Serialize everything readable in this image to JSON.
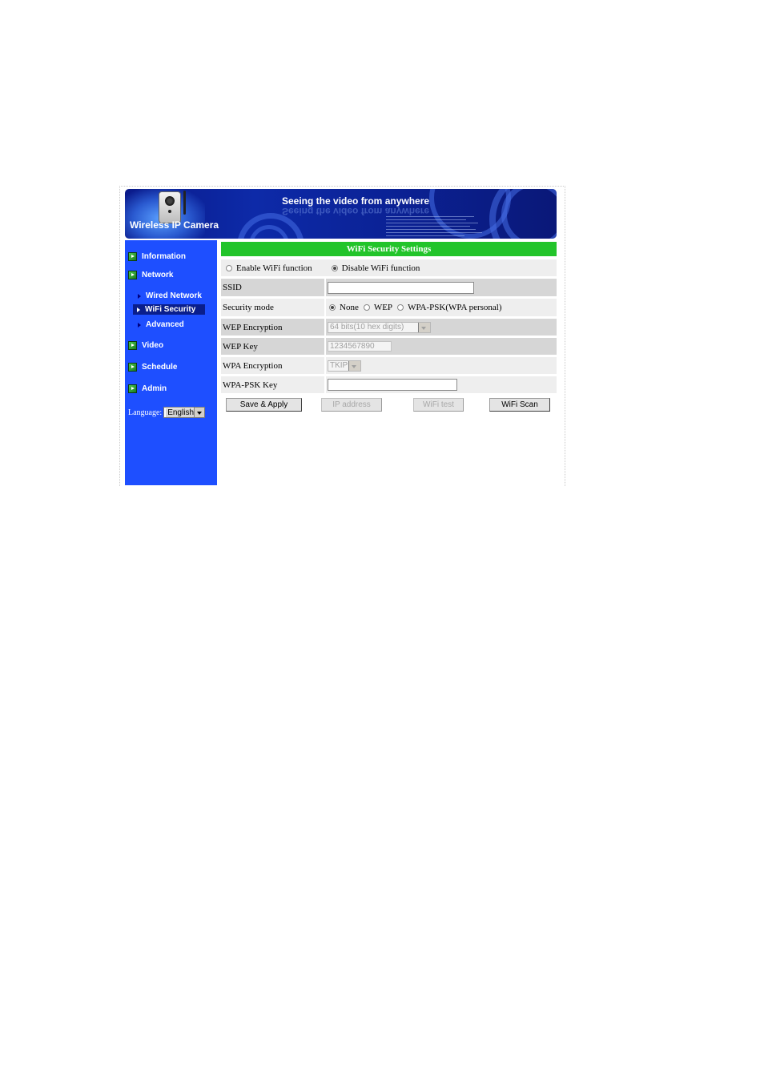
{
  "banner": {
    "title": "Wireless IP Camera",
    "slogan": "Seeing the video from anywhere"
  },
  "sidebar": {
    "items": [
      {
        "label": "Information"
      },
      {
        "label": "Network"
      },
      {
        "label": "Video"
      },
      {
        "label": "Schedule"
      },
      {
        "label": "Admin"
      }
    ],
    "network_sub": [
      {
        "label": "Wired Network"
      },
      {
        "label": "WiFi Security",
        "active": true
      },
      {
        "label": "Advanced"
      }
    ],
    "language_label": "Language:",
    "language_value": "English"
  },
  "form": {
    "title": "WiFi Security Settings",
    "enable_wifi": "Enable WiFi function",
    "disable_wifi": "Disable WiFi function",
    "wifi_selected": "disable",
    "ssid_label": "SSID",
    "ssid_value": "",
    "security_mode_label": "Security mode",
    "mode_none": "None",
    "mode_wep": "WEP",
    "mode_wpa": "WPA-PSK(WPA personal)",
    "mode_selected": "None",
    "wep_encryption_label": "WEP Encryption",
    "wep_encryption_value": "64 bits(10 hex digits)",
    "wep_key_label": "WEP Key",
    "wep_key_value": "1234567890",
    "wpa_encryption_label": "WPA Encryption",
    "wpa_encryption_value": "TKIP",
    "wpa_psk_key_label": "WPA-PSK Key",
    "wpa_psk_key_value": ""
  },
  "buttons": {
    "save_apply": "Save & Apply",
    "ip_address": "IP address",
    "wifi_test": "WiFi test",
    "wifi_scan": "WiFi Scan"
  }
}
